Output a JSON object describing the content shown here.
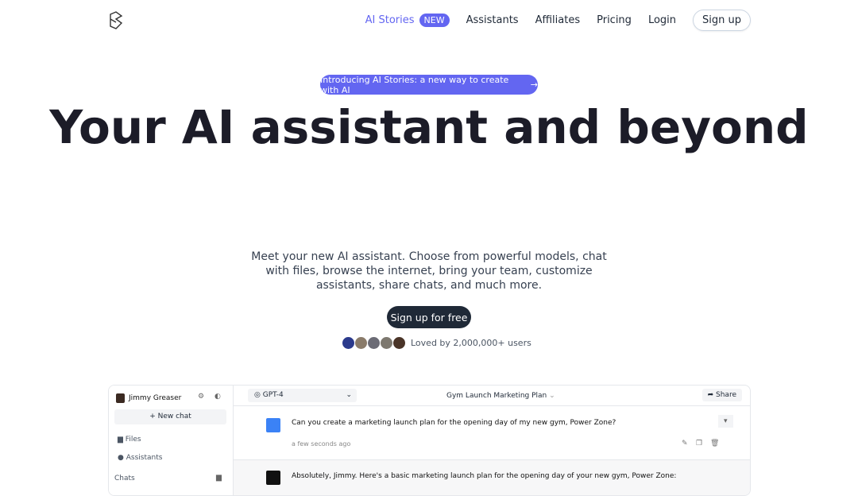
{
  "nav": {
    "ai_stories": "AI Stories",
    "new_badge": "NEW",
    "assistants": "Assistants",
    "affiliates": "Affiliates",
    "pricing": "Pricing",
    "login": "Login",
    "signup": "Sign up"
  },
  "hero": {
    "pill": "Introducing AI Stories: a new way to create with AI",
    "pill_arrow": "→",
    "title": "Your AI assistant and beyond",
    "subtitle": "Meet your new AI assistant. Choose from powerful models, chat with files, browse the internet, bring your team, customize assistants, share chats, and much more.",
    "cta": "Sign up for free",
    "loved": "Loved by 2,000,000+ users"
  },
  "colors": {
    "accent": "#6366f1",
    "dark": "#1f2937"
  },
  "app": {
    "user": "Jimmy Greaser",
    "new_chat": "+ New chat",
    "files": "Files",
    "assistants": "Assistants",
    "chats": "Chats",
    "model": "GPT-4",
    "chat_title": "Gym Launch Marketing Plan",
    "share": "Share",
    "user_message": "Can you create a marketing launch plan for the opening day of my new gym, Power Zone?",
    "timestamp": "a few seconds ago",
    "bot_message": "Absolutely, Jimmy. Here's a basic marketing launch plan for the opening day of your new gym, Power Zone:"
  }
}
